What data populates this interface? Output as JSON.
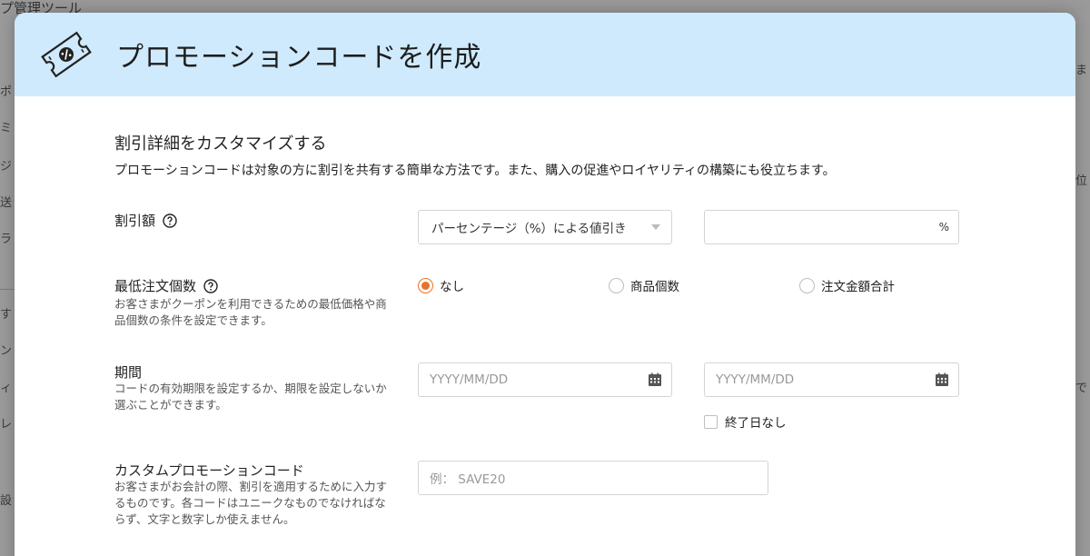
{
  "background": {
    "title_fragment": "プ管理ツール",
    "left_fragments": [
      "ポ",
      "ミ",
      "ジ",
      "送",
      "ラ",
      "す",
      "ン",
      "ィ",
      "レ",
      "設"
    ],
    "right_fragments": [
      "ま",
      "位",
      "で"
    ]
  },
  "modal": {
    "title": "プロモーションコードを作成",
    "header_icon": "coupon-ticket-icon",
    "section_heading": "割引詳細をカスタマイズする",
    "section_description": "プロモーションコードは対象の方に割引を共有する簡単な方法です。また、購入の促進やロイヤリティの構築にも役立ちます。",
    "discount": {
      "label": "割引額",
      "type_selected": "パーセンテージ（%）による値引き",
      "value": "",
      "suffix": "%"
    },
    "minimum": {
      "label": "最低注文個数",
      "hint": "お客さまがクーポンを利用できるための最低価格や商品個数の条件を設定できます。",
      "options": [
        {
          "label": "なし",
          "checked": true
        },
        {
          "label": "商品個数",
          "checked": false
        },
        {
          "label": "注文金額合計",
          "checked": false
        }
      ]
    },
    "period": {
      "label": "期間",
      "hint": "コードの有効期限を設定するか、期限を設定しないか選ぶことができます。",
      "start_placeholder": "YYYY/MM/DD",
      "end_placeholder": "YYYY/MM/DD",
      "no_end_label": "終了日なし",
      "no_end_checked": false
    },
    "custom_code": {
      "label": "カスタムプロモーションコード",
      "hint": "お客さまがお会計の際、割引を適用するために入力するものです。各コードはユニークなものでなければならず、文字と数字しか使えません。",
      "placeholder": "例： SAVE20"
    }
  },
  "colors": {
    "header_bg": "#cfeafd",
    "accent_radio": "#e8722a"
  }
}
